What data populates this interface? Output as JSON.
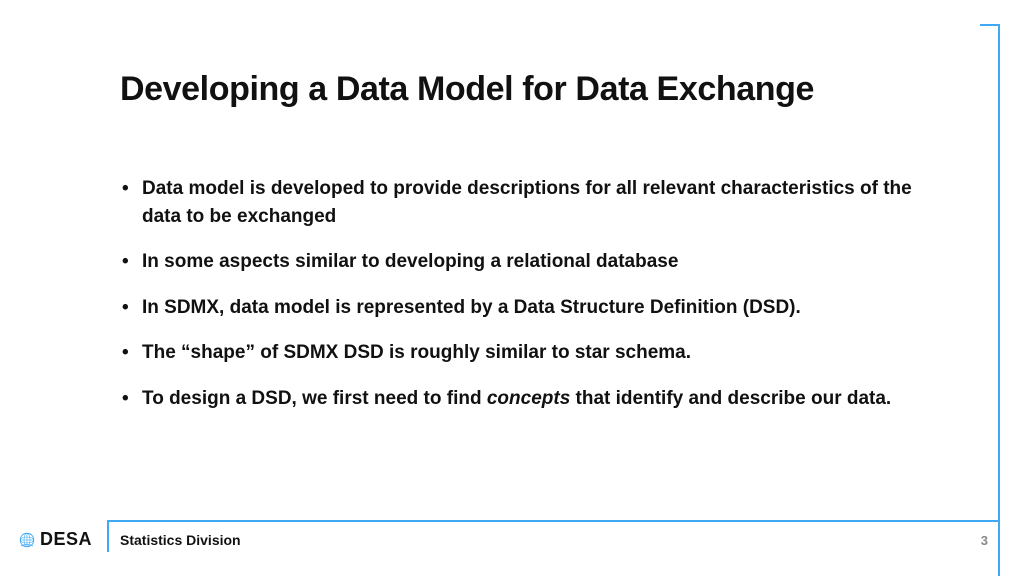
{
  "title": "Developing a Data Model for Data Exchange",
  "bullets": [
    {
      "text": "Data model is developed to provide descriptions for all relevant characteristics of the data to be exchanged"
    },
    {
      "text": "In some aspects similar to developing a relational database"
    },
    {
      "text": "In SDMX, data model is represented by a Data Structure Definition (DSD)."
    },
    {
      "text": "The “shape” of SDMX DSD is roughly similar to star schema."
    },
    {
      "pre": "To design a DSD, we first need to find ",
      "em": "concepts",
      "post": " that identify and describe our data."
    }
  ],
  "footer": {
    "logo_text": "DESA",
    "division": "Statistics Division",
    "page": "3"
  }
}
